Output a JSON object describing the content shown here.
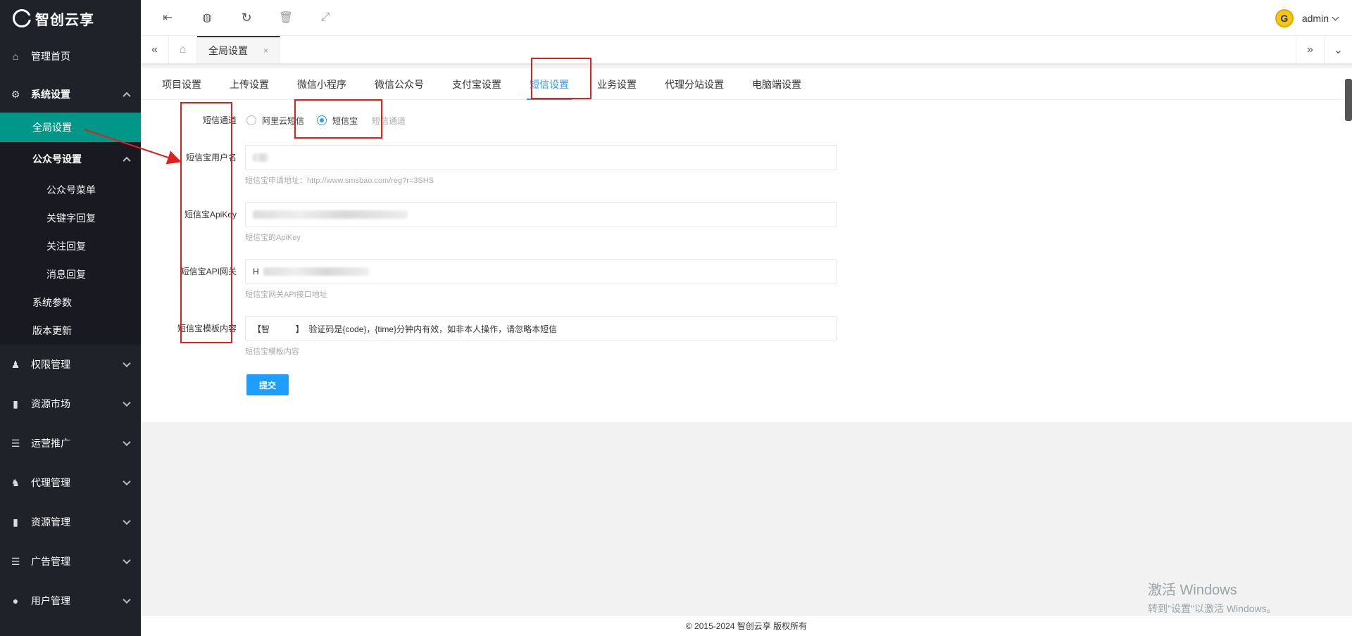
{
  "sidebar": {
    "logo_text": "智创云享",
    "items": [
      {
        "label": "管理首页",
        "icon": "home-icon"
      },
      {
        "label": "系统设置",
        "icon": "gear-icon"
      },
      {
        "label": "权限管理",
        "icon": "key-users-icon"
      },
      {
        "label": "资源市场",
        "icon": "book-icon"
      },
      {
        "label": "运营推广",
        "icon": "list-icon"
      },
      {
        "label": "代理管理",
        "icon": "users-icon"
      },
      {
        "label": "资源管理",
        "icon": "book-icon"
      },
      {
        "label": "广告管理",
        "icon": "list-icon"
      },
      {
        "label": "用户管理",
        "icon": "user-icon"
      }
    ],
    "system_sub": {
      "global": "全局设置",
      "gzh_group": "公众号设置",
      "gzh_items": [
        "公众号菜单",
        "关键字回复",
        "关注回复",
        "消息回复"
      ],
      "params": "系统参数",
      "update": "版本更新"
    }
  },
  "topbar": {
    "user": "admin",
    "avatar_letter": "G"
  },
  "tabstrip": {
    "current_tab": "全局设置",
    "close": "×"
  },
  "settings_tabs": [
    "项目设置",
    "上传设置",
    "微信小程序",
    "微信公众号",
    "支付宝设置",
    "短信设置",
    "业务设置",
    "代理分站设置",
    "电脑端设置"
  ],
  "form": {
    "channel_label": "短信通道",
    "channel_opt1": "阿里云短信",
    "channel_opt2": "短信宝",
    "channel_note": "短信通道",
    "username_label": "短信宝用户名",
    "username_hint": "短信宝申请地址：http://www.smsbao.com/reg?r=3SHS",
    "apikey_label": "短信宝ApiKey",
    "apikey_hint": "短信宝的ApiKey",
    "gateway_label": "短信宝API网关",
    "gateway_value": "H",
    "gateway_hint": "短信宝网关API接口地址",
    "template_label": "短信宝模板内容",
    "template_value": "【智           】  验证码是{code}，{time}分钟内有效，如非本人操作，请忽略本短信",
    "template_hint": "短信宝模板内容",
    "submit": "提交"
  },
  "watermark": {
    "line1": "激活 Windows",
    "line2": "转到\"设置\"以激活 Windows。"
  },
  "footer": "© 2015-2024 智创云享 版权所有",
  "colors": {
    "sidebar_bg": "#20222a",
    "active_green": "#009688",
    "accent_blue": "#1e9fff",
    "annotation_red": "#e02020"
  }
}
